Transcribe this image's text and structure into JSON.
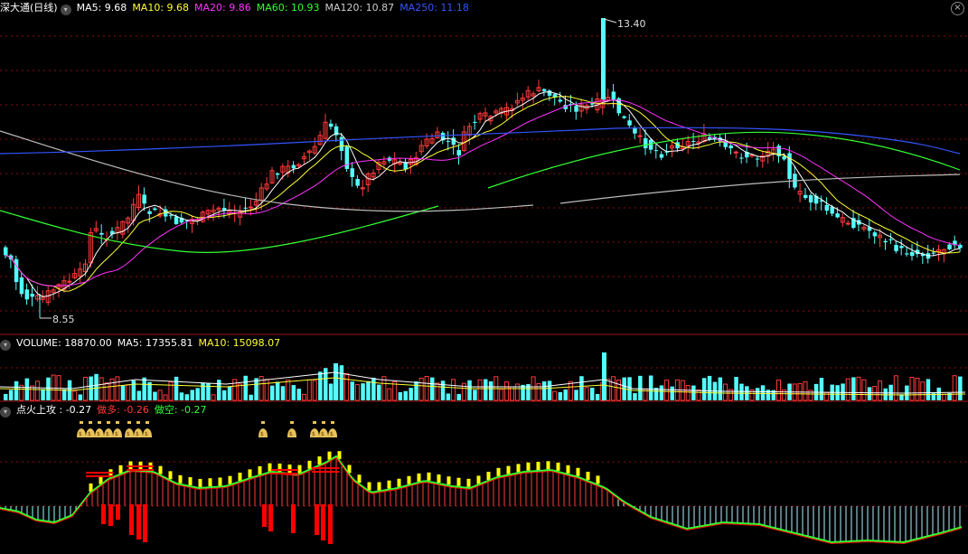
{
  "colors": {
    "up": "#ff3b3b",
    "down": "#54ffff",
    "ma5": "#ffffff",
    "ma10": "#ffff33",
    "ma20": "#ff33ff",
    "ma60": "#33ff33",
    "ma120": "#bbbbbb",
    "ma250": "#3355ff",
    "grid": "#8a1010",
    "white": "#ffffff",
    "yellow": "#ffff00",
    "red": "#ff0000",
    "green": "#33ff33",
    "gold": "#e8c25a"
  },
  "price_header": {
    "stock_name": "深大通(日线)",
    "ma5": "MA5: 9.68",
    "ma10": "MA10: 9.68",
    "ma20": "MA20: 9.86",
    "ma60": "MA60: 10.93",
    "ma120": "MA120: 10.87",
    "ma250": "MA250: 11.18"
  },
  "price_labels": {
    "high": "13.40",
    "low": "8.55"
  },
  "volume_header": {
    "volume": "VOLUME: 18870.00",
    "ma5": "MA5: 17355.81",
    "ma10": "MA10: 15098.07"
  },
  "indicator_header": {
    "name": "点火上攻 : -0.27",
    "long": "做多: -0.26",
    "short": "做空: -0.27"
  },
  "icons": {
    "collapse": "chevron-down-icon",
    "close": "close-icon",
    "signal": "money-bag-icon"
  },
  "chart_data": [
    {
      "type": "candlestick",
      "series_count": 180,
      "y_range": [
        8.55,
        13.4
      ],
      "high_mark": 13.4,
      "low_mark": 8.55,
      "moving_averages": [
        {
          "name": "MA5",
          "last": 9.68
        },
        {
          "name": "MA10",
          "last": 9.68
        },
        {
          "name": "MA20",
          "last": 9.86
        },
        {
          "name": "MA60",
          "last": 10.93
        },
        {
          "name": "MA120",
          "last": 10.87
        },
        {
          "name": "MA250",
          "last": 11.18
        }
      ]
    },
    {
      "type": "bar",
      "name": "VOLUME",
      "last": 18870.0,
      "ma5": 17355.81,
      "ma10": 15098.07
    },
    {
      "type": "line",
      "name": "点火上攻",
      "values": {
        "点火上攻": -0.27,
        "做多": -0.26,
        "做空": -0.27
      }
    }
  ]
}
